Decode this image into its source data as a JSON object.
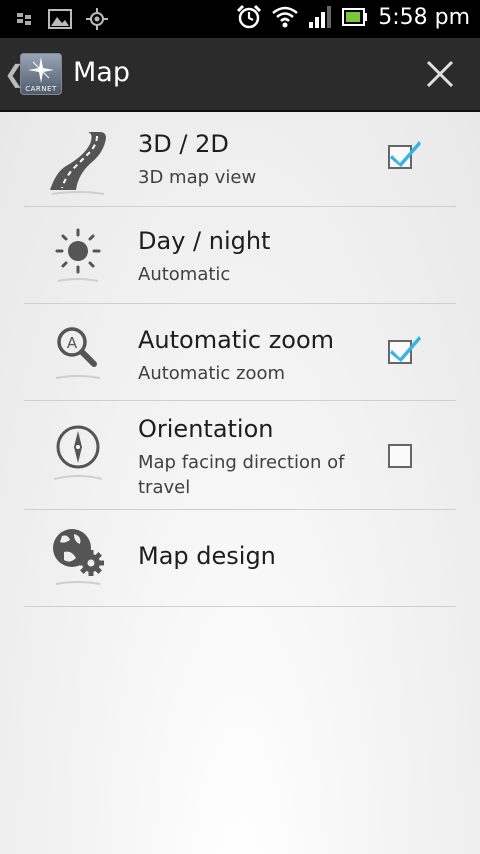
{
  "status_bar": {
    "time": "5:58 pm",
    "icons": [
      "bbm-notification-icon",
      "gallery-icon",
      "gps-icon",
      "alarm-icon",
      "wifi-icon",
      "signal-icon",
      "battery-icon"
    ]
  },
  "app_bar": {
    "back_glyph": "❮",
    "logo_label": "CARNET",
    "title": "Map",
    "close_icon": "close-icon"
  },
  "settings": [
    {
      "title": "3D / 2D",
      "subtitle": "3D map view",
      "checkbox": true,
      "checked": true,
      "icon": "road-3d-icon"
    },
    {
      "title": "Day / night",
      "subtitle": "Automatic",
      "checkbox": false,
      "icon": "sun-icon"
    },
    {
      "title": "Automatic zoom",
      "subtitle": "Automatic zoom",
      "checkbox": true,
      "checked": true,
      "icon": "zoom-icon"
    },
    {
      "title": "Orientation",
      "subtitle": "Map facing direction of travel",
      "checkbox": true,
      "checked": false,
      "icon": "compass-icon"
    },
    {
      "title": "Map design",
      "subtitle": "",
      "checkbox": false,
      "icon": "globe-gear-icon"
    }
  ],
  "colors": {
    "check_accent": "#33b5e5",
    "app_bar_bg": "#2b2b2b",
    "status_bar_bg": "#000000"
  }
}
